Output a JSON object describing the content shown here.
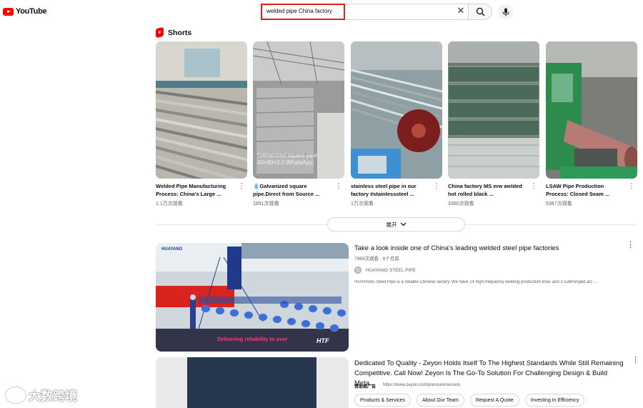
{
  "app": {
    "logo_text": "YouTube"
  },
  "search": {
    "query": "welded pipe China factory"
  },
  "shorts": {
    "heading": "Shorts",
    "items": [
      {
        "title": "Welded Pipe Manufacturing Process: China's Large ...",
        "views": "1.1万次观看",
        "overlay": ""
      },
      {
        "title": "💧Galvanized square pipe.Direct from Source ...",
        "views": "1891次观看",
        "overlay": "Galvanized square pipe 40×60×2.0 WhatsApp:"
      },
      {
        "title": "stainless steel pipe in our factory #stainlesssteel ...",
        "views": "1万次观看",
        "overlay": ""
      },
      {
        "title": "China factory MS erw welded hot rolled black ...",
        "views": "3360次观看",
        "overlay": ""
      },
      {
        "title": "LSAW Pipe Production Process: Closed Seam ...",
        "views": "5387次观看",
        "overlay": ""
      }
    ],
    "expand_label": "展开"
  },
  "video1": {
    "title": "Take a look inside one of China's leading welded steel pipe factories",
    "meta": "7969次观看 · 6个月前",
    "channel": "HUAYANG STEEL PIPE",
    "description": "HUAYANG Steel Pipe is a reliable Chinese factory. We have 14 high-frequency welding production lines and 3 submerged arc ...",
    "thumb_brand": "HUAYANG",
    "thumb_caption": "Delivering reliability to over",
    "thumb_badge": "HTF"
  },
  "ad": {
    "title": "Dedicated To Quality - Zeyon Holds Itself To The Highest Standards While Still Remaining Competitive. Call Now! Zeyon Is The Go-To Solution For Challenging Design & Build Meta...",
    "sponsored": "赞助商广告",
    "url": "https://www.zeyon.com/pressure/vessels",
    "links": [
      "Products & Services",
      "About Our Team",
      "Request A Quote",
      "Investing In Efficiency"
    ]
  },
  "watermark": {
    "text": "大数跨境"
  }
}
